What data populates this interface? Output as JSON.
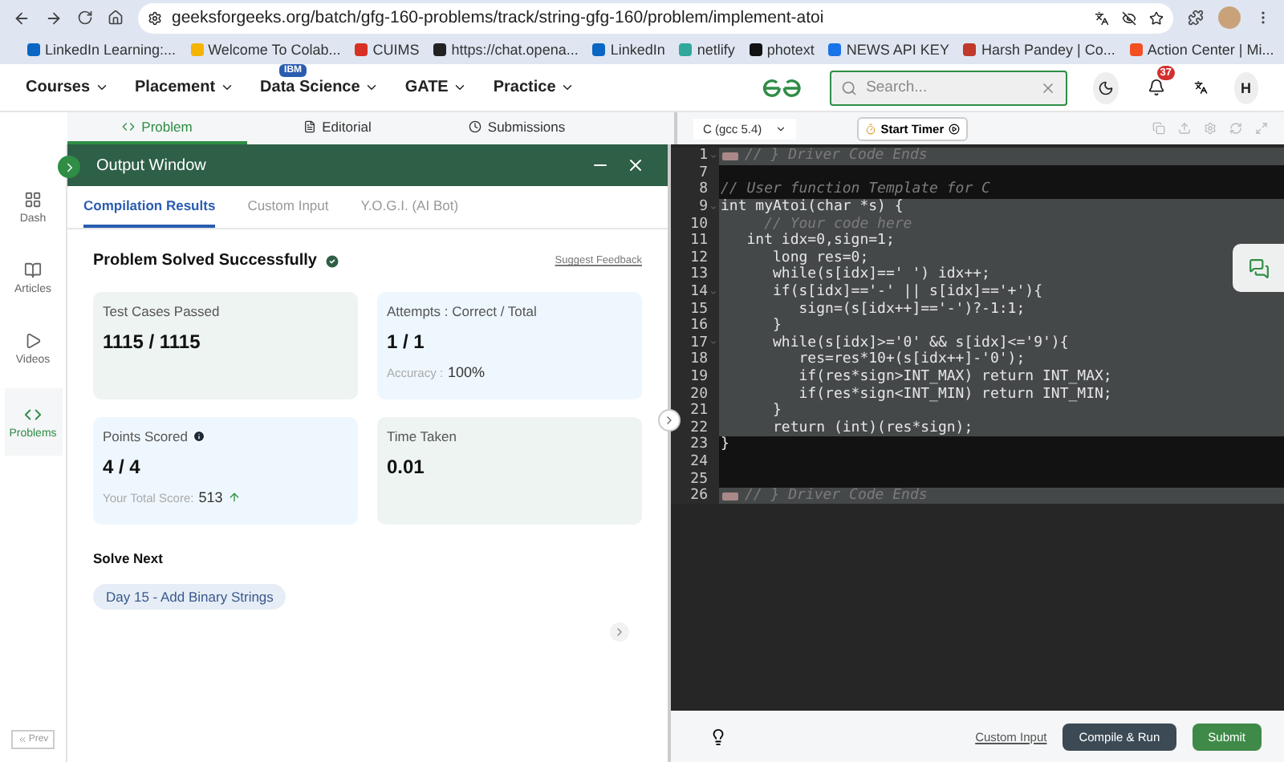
{
  "browser": {
    "url": "geeksforgeeks.org/batch/gfg-160-problems/track/string-gfg-160/problem/implement-atoi",
    "bookmarks": [
      {
        "label": "LinkedIn Learning:...",
        "color": "#0a66c2"
      },
      {
        "label": "Welcome To Colab...",
        "color": "#f4b400"
      },
      {
        "label": "CUIMS",
        "color": "#d93025"
      },
      {
        "label": "https://chat.opena...",
        "color": "#222222"
      },
      {
        "label": "LinkedIn",
        "color": "#0a66c2"
      },
      {
        "label": "netlify",
        "color": "#32a89c"
      },
      {
        "label": "photext",
        "color": "#111111"
      },
      {
        "label": "NEWS API KEY",
        "color": "#1a73e8"
      },
      {
        "label": "Harsh Pandey | Co...",
        "color": "#c0392b"
      },
      {
        "label": "Action Center | Mi...",
        "color": "#f25022"
      }
    ]
  },
  "nav": {
    "items": [
      {
        "label": "Courses"
      },
      {
        "label": "Placement"
      },
      {
        "label": "Data Science",
        "badge": "IBM"
      },
      {
        "label": "GATE"
      },
      {
        "label": "Practice"
      }
    ],
    "search": {
      "placeholder": "Search..."
    },
    "notifications": "37",
    "avatar": "H"
  },
  "problem_tabs": [
    {
      "label": "Problem",
      "kind": "code",
      "selected": true
    },
    {
      "label": "Editorial",
      "kind": "doc",
      "selected": false
    },
    {
      "label": "Submissions",
      "kind": "clock",
      "selected": false
    }
  ],
  "sidebar": {
    "items": [
      {
        "label": "Dash",
        "kind": "grid",
        "selected": false
      },
      {
        "label": "Articles",
        "kind": "book",
        "selected": false
      },
      {
        "label": "Videos",
        "kind": "video",
        "selected": false
      },
      {
        "label": "Problems",
        "kind": "code",
        "selected": true
      }
    ],
    "prev": "Prev"
  },
  "output_window": {
    "title": "Output Window",
    "tabs": [
      {
        "label": "Compilation Results",
        "selected": true
      },
      {
        "label": "Custom Input",
        "selected": false
      },
      {
        "label": "Y.O.G.I. (AI Bot)",
        "selected": false
      }
    ],
    "status": "Problem Solved Successfully",
    "feedback": "Suggest Feedback",
    "cards": [
      {
        "label": "Test Cases Passed",
        "value": "1115 / 1115",
        "color": "#eef4f1"
      },
      {
        "label": "Attempts : Correct / Total",
        "value": "1 / 1",
        "note_label": "Accuracy :",
        "note_value": "100%",
        "color": "#eef7fd"
      },
      {
        "label": "Points Scored",
        "info": true,
        "value": "4 / 4",
        "note_label": "Your Total Score:",
        "note_value": "513",
        "rising": true,
        "color": "#eef7fd"
      },
      {
        "label": "Time Taken",
        "value": "0.01",
        "color": "#eef4f1"
      }
    ],
    "solve_next": {
      "title": "Solve Next",
      "items": [
        "Day 15 - Add Binary Strings"
      ]
    }
  },
  "editor": {
    "language": "C (gcc 5.4)",
    "timer": "Start Timer",
    "lines": [
      {
        "number": "1",
        "text": "// } Driver Code Ends",
        "kind": "comment",
        "folded": true,
        "foldable": true,
        "selected": true
      },
      {
        "number": "7",
        "folded": false,
        "foldable": false,
        "selected": false
      },
      {
        "number": "8",
        "text": "// User function Template for C",
        "kind": "comment",
        "folded": false,
        "foldable": false,
        "selected": false
      },
      {
        "number": "9",
        "text": "int myAtoi(char *s) {",
        "kind": "code",
        "folded": false,
        "foldable": true,
        "selected": true
      },
      {
        "number": "10",
        "text": "     // Your code here",
        "kind": "comment",
        "folded": false,
        "foldable": false,
        "selected": true
      },
      {
        "number": "11",
        "text": "   int idx=0,sign=1;",
        "kind": "code",
        "folded": false,
        "foldable": false,
        "selected": true
      },
      {
        "number": "12",
        "text": "      long res=0;",
        "kind": "code",
        "folded": false,
        "foldable": false,
        "selected": true
      },
      {
        "number": "13",
        "text": "      while(s[idx]==' ') idx++;",
        "kind": "code",
        "folded": false,
        "foldable": false,
        "selected": true
      },
      {
        "number": "14",
        "text": "      if(s[idx]=='-' || s[idx]=='+'){",
        "kind": "code",
        "folded": false,
        "foldable": true,
        "selected": true
      },
      {
        "number": "15",
        "text": "         sign=(s[idx++]=='-')?-1:1;",
        "kind": "code",
        "folded": false,
        "foldable": false,
        "selected": true
      },
      {
        "number": "16",
        "text": "      }",
        "kind": "code",
        "folded": false,
        "foldable": false,
        "selected": true
      },
      {
        "number": "17",
        "text": "      while(s[idx]>='0' && s[idx]<='9'){",
        "kind": "code",
        "folded": false,
        "foldable": true,
        "selected": true
      },
      {
        "number": "18",
        "text": "         res=res*10+(s[idx++]-'0');",
        "kind": "code",
        "folded": false,
        "foldable": false,
        "selected": true
      },
      {
        "number": "19",
        "text": "         if(res*sign>INT_MAX) return INT_MAX;",
        "kind": "code",
        "folded": false,
        "foldable": false,
        "selected": true
      },
      {
        "number": "20",
        "text": "         if(res*sign<INT_MIN) return INT_MIN;",
        "kind": "code",
        "folded": false,
        "foldable": false,
        "selected": true
      },
      {
        "number": "21",
        "text": "      }",
        "kind": "code",
        "folded": false,
        "foldable": false,
        "selected": true
      },
      {
        "number": "22",
        "text": "      return (int)(res*sign);",
        "kind": "code",
        "folded": false,
        "foldable": false,
        "selected": true
      },
      {
        "number": "23",
        "text": "}",
        "kind": "code",
        "folded": false,
        "foldable": false,
        "selected": false
      },
      {
        "number": "24",
        "folded": false,
        "foldable": false,
        "selected": false
      },
      {
        "number": "25",
        "folded": false,
        "foldable": false,
        "selected": false
      },
      {
        "number": "26",
        "text": "// } Driver Code Ends",
        "kind": "comment",
        "folded": true,
        "foldable": false,
        "selected": true
      }
    ],
    "custom_input": "Custom Input",
    "compile": "Compile & Run",
    "submit": "Submit"
  }
}
